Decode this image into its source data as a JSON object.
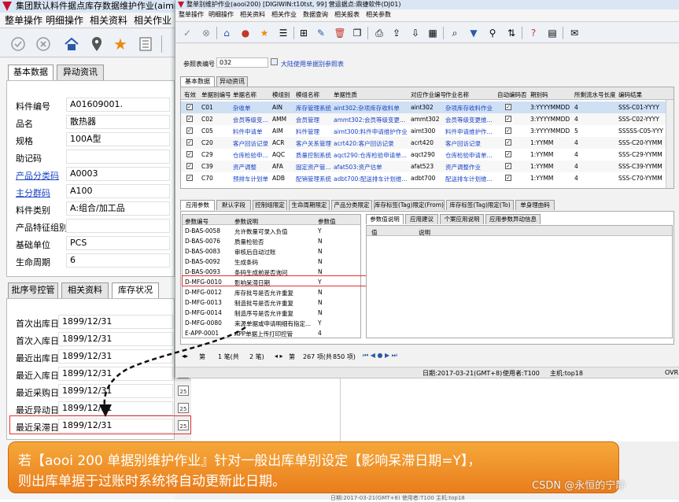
{
  "back_window": {
    "title": "集团默认料件据点库存数据维护作业(aimm2",
    "menu": [
      "整单操作",
      "明细操作",
      "相关资料",
      "相关作业"
    ],
    "toolbar_icons": [
      "check-icon",
      "cancel-icon",
      "home-icon",
      "pin-icon",
      "star-icon",
      "list-icon"
    ],
    "top_tabs": [
      "基本数据",
      "异动资讯"
    ],
    "fields": [
      {
        "label": "料件编号",
        "value": "A01609001.",
        "link": false
      },
      {
        "label": "品名",
        "value": "散热器",
        "link": false
      },
      {
        "label": "规格",
        "value": "100A型",
        "link": false
      },
      {
        "label": "助记码",
        "value": "",
        "link": false
      },
      {
        "label": "产品分类码",
        "value": "A0003",
        "link": true
      },
      {
        "label": "主分群码",
        "value": "A100",
        "link": true
      },
      {
        "label": "料件类别",
        "value": "A:组合/加工品",
        "link": false
      },
      {
        "label": "产品特征组别",
        "value": "",
        "link": false
      },
      {
        "label": "基础单位",
        "value": "PCS",
        "link": false
      },
      {
        "label": "生命周期",
        "value": "6",
        "link": false
      }
    ],
    "bottom_tabs": [
      "批序号控管",
      "相关资料",
      "库存状况"
    ],
    "dates": [
      {
        "label": "首次出库日",
        "value": "1899/12/31"
      },
      {
        "label": "首次入库日",
        "value": "1899/12/31"
      },
      {
        "label": "最近出库日",
        "value": "1899/12/31"
      },
      {
        "label": "最近入库日",
        "value": "1899/12/31"
      },
      {
        "label": "最近采购日",
        "value": "1899/12/31"
      },
      {
        "label": "最近异动日",
        "value": "1899/12/31"
      },
      {
        "label": "最近呆滞日",
        "value": "1899/12/31"
      }
    ],
    "calendar_icon_text": "25"
  },
  "front_window": {
    "title": "整单别维护作业(aooi200)    [DIGIWIN:t10tst, 99]    营运据点:鼎捷软件(DJ01)",
    "menu": [
      "整单操作",
      "明细操作",
      "相关资料",
      "相关作业",
      "数据查询",
      "相关报表",
      "相关参数"
    ],
    "ref_label": "参照表编号",
    "ref_value": "032",
    "ref_desc": "大陆使用单据别参照表",
    "tabs": [
      "基本数据",
      "异动资讯"
    ],
    "grid_headers": [
      "有效",
      "单据别编号",
      "单据名称",
      "模组别",
      "模组名称",
      "单据性质",
      "对应作业编号",
      "作业名称",
      "自动编码否",
      "期别码",
      "所剩流水号长度",
      "编码结果"
    ],
    "grid_rows": [
      [
        "C01",
        "杂收单",
        "AIN",
        "库存管理系统",
        "aint302:杂项库存收料单",
        "aint302",
        "杂项库存收料作业",
        "8",
        "3:YYYYMMDD",
        "4",
        "SSS-C01-YYYY"
      ],
      [
        "C02",
        "会员等级变...",
        "AMM",
        "会员管理",
        "ammt302:会员等级变更...",
        "ammt302",
        "会员等级变更维...",
        "8",
        "3:YYYYMMDD",
        "4",
        "SSS-C02-YYYY"
      ],
      [
        "C05",
        "料件申请单",
        "AIM",
        "料件管理",
        "aimt300:料件申请维护作业",
        "aimt300",
        "料件申请维护作...",
        "8",
        "3:YYYYMMDD",
        "5",
        "SSSSS-C05-YYY"
      ],
      [
        "C20",
        "客户回访记录",
        "ACR",
        "客户关系管理",
        "acrt420:客户回访记录",
        "acrt420",
        "客户回访记录",
        "8",
        "1:YYMM",
        "4",
        "SSS-C20-YYMM"
      ],
      [
        "C29",
        "仓库检验申...",
        "AQC",
        "质量控制系统",
        "aqct290:仓库检验申请单...",
        "aqct290",
        "仓库检验申请单...",
        "8",
        "1:YYMM",
        "4",
        "SSS-C29-YYMM"
      ],
      [
        "C39",
        "资产调整",
        "AFA",
        "固定资产管...",
        "afat503:资产估单",
        "afat523",
        "资产调整作业",
        "8",
        "1:YYMM",
        "4",
        "SSS-C39-YYMM"
      ],
      [
        "C70",
        "预排车计划单",
        "ADB",
        "配销管理系统",
        "adbt700:配送排车计划维...",
        "adbt700",
        "配送排车计划维...",
        "8",
        "1:YYMM",
        "4",
        "SSS-C70-YYMM"
      ]
    ],
    "sub_tabs": [
      "应用参数",
      "默认字段",
      "控制组限定",
      "生命周期限定",
      "产品分类限定",
      "库存标签(Tag)限定(From)",
      "库存标签(Tag)限定(To)",
      "单身理由码"
    ],
    "param_headers": [
      "参数编号",
      "参数说明",
      "参数值"
    ],
    "params": [
      [
        "D-BAS-0058",
        "允许数量可录入负值",
        "Y"
      ],
      [
        "D-BAS-0076",
        "质量检验否",
        "N"
      ],
      [
        "D-BAS-0083",
        "审核后自动过账",
        "N"
      ],
      [
        "D-BAS-0092",
        "生成条码",
        "N"
      ],
      [
        "D-BAS-0093",
        "条码生成前是否询问",
        "N"
      ],
      [
        "D-MFG-0010",
        "影响呆滞日期",
        "Y"
      ],
      [
        "D-MFG-0012",
        "库存批号是否允许重复",
        "N"
      ],
      [
        "D-MFG-0013",
        "制造批号是否允许重复",
        "N"
      ],
      [
        "D-MFG-0014",
        "制造序号是否允许重复",
        "N"
      ],
      [
        "D-MFG-0080",
        "来源单据或申请明细有指定...",
        "Y"
      ],
      [
        "E-APP-0001",
        "APP单据上传打印控管",
        "4"
      ]
    ],
    "right_tabs": [
      "参数值说明",
      "应用建议",
      "个案应用说明",
      "应用参数异动信息"
    ],
    "right_headers": [
      "值",
      "说明"
    ],
    "pager": {
      "first": "第",
      "current": "1 笔(共",
      "total": "2 笔)",
      "page_label": "第",
      "page_info": "267 项(共",
      "page_total": "850 项)"
    },
    "status": {
      "date": "日期:2017-03-21(GMT+8)",
      "user": "使用者:T100",
      "host": "主机:top18",
      "right": "OVR"
    }
  },
  "annotation": {
    "line1": "若【aooi 200 单据别维护作业』针对一般出库单别设定【影响呆滞日期=Y】，",
    "line2": "则出库单据于过账时系统将自动更新此日期。"
  },
  "watermark": "CSDN @永恒的宁静",
  "footer_text": "日期:2017-03-21(GMT+8)    使用者:T100    主机:top18",
  "colors": {
    "accent_red": "#e1322e",
    "callout_orange": "#ef8a25",
    "link_blue": "#1a44c7"
  }
}
